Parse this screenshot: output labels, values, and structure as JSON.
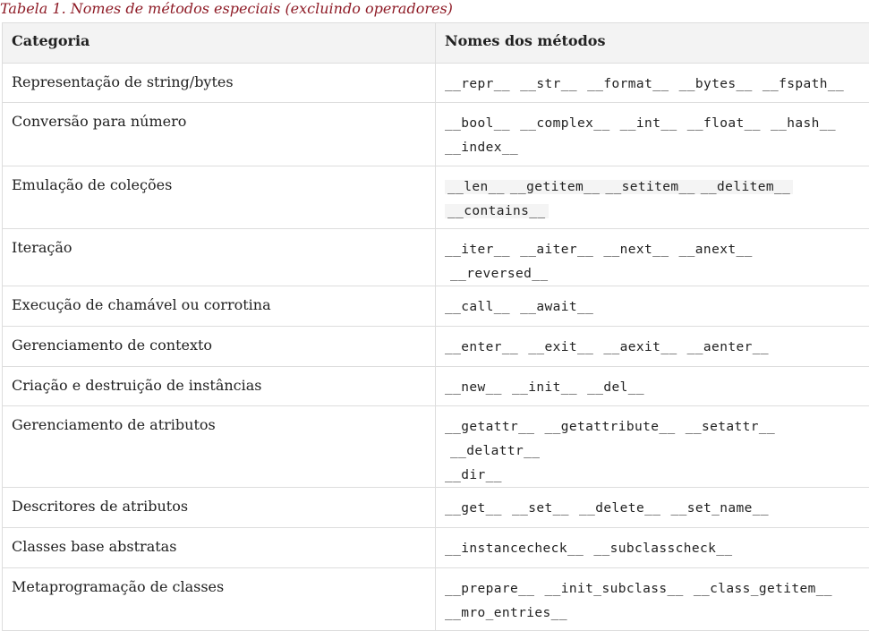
{
  "caption": "Tabela 1. Nomes de métodos especiais (excluindo operadores)",
  "table": {
    "headers": [
      "Categoria",
      "Nomes dos métodos"
    ],
    "rows": [
      {
        "category": "Representação de string/bytes",
        "methods": [
          "__repr__",
          "__str__",
          "__format__",
          "__bytes__",
          "__fspath__"
        ]
      },
      {
        "category": "Conversão para número",
        "methods": [
          "__bool__",
          "__complex__",
          "__int__",
          "__float__",
          "__hash__",
          "__index__"
        ]
      },
      {
        "category": "Emulação de coleções",
        "methods": [
          "__len__",
          "__getitem__",
          "__setitem__",
          "__delitem__",
          "__contains__"
        ]
      },
      {
        "category": "Iteração",
        "methods": [
          "__iter__",
          "__aiter__",
          "__next__",
          "__anext__",
          "__reversed__"
        ]
      },
      {
        "category": "Execução de chamável ou corrotina",
        "methods": [
          "__call__",
          "__await__"
        ]
      },
      {
        "category": "Gerenciamento de contexto",
        "methods": [
          "__enter__",
          "__exit__",
          "__aexit__",
          "__aenter__"
        ]
      },
      {
        "category": "Criação e destruição de instâncias",
        "methods": [
          "__new__",
          "__init__",
          "__del__"
        ]
      },
      {
        "category": "Gerenciamento de atributos",
        "methods": [
          "__getattr__",
          "__getattribute__",
          "__setattr__",
          "__delattr__",
          "__dir__"
        ]
      },
      {
        "category": "Descritores de atributos",
        "methods": [
          "__get__",
          "__set__",
          "__delete__",
          "__set_name__"
        ]
      },
      {
        "category": "Classes base abstratas",
        "methods": [
          "__instancecheck__",
          "__subclasscheck__"
        ]
      },
      {
        "category": "Metaprogramação de classes",
        "methods": [
          "__prepare__",
          "__init_subclass__",
          "__class_getitem__",
          "__mro_entries__"
        ]
      }
    ]
  }
}
